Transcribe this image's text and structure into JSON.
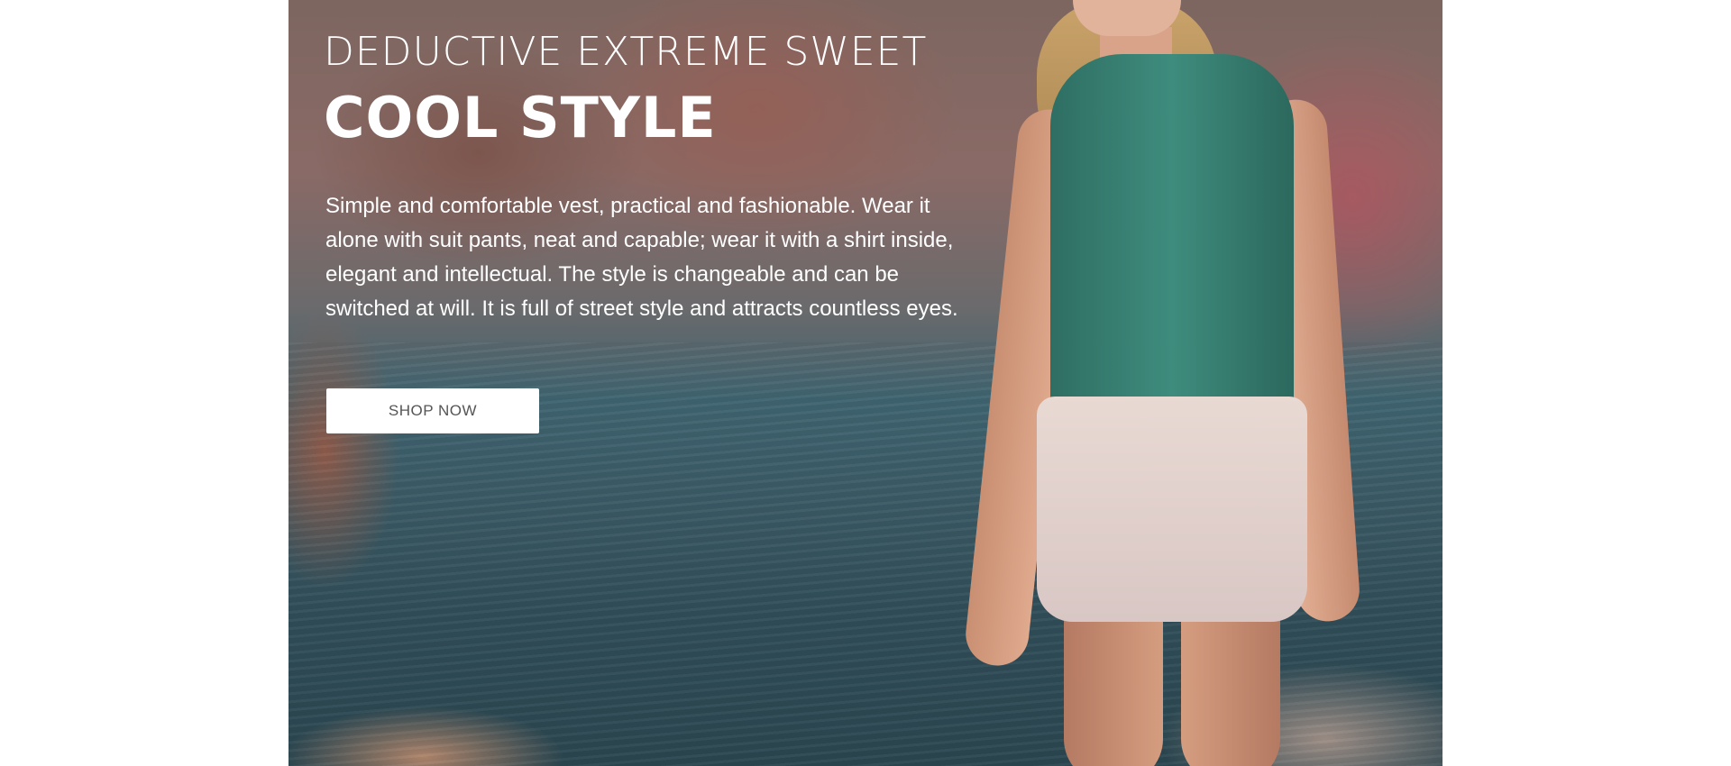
{
  "hero": {
    "kicker": "DEDUCTIVE EXTREME SWEET",
    "headline": "COOL STYLE",
    "description": "Simple and comfortable vest, practical and fashionable. Wear it alone with suit pants, neat and capable; wear it with a shirt inside, elegant and intellectual. The style is changeable and can be switched at will. It is full of street style and attracts countless eyes.",
    "cta_label": "SHOP NOW"
  },
  "colors": {
    "page_background": "#ffffff",
    "hero_text": "#ffffff",
    "button_background": "#ffffff",
    "button_text": "#555555"
  }
}
